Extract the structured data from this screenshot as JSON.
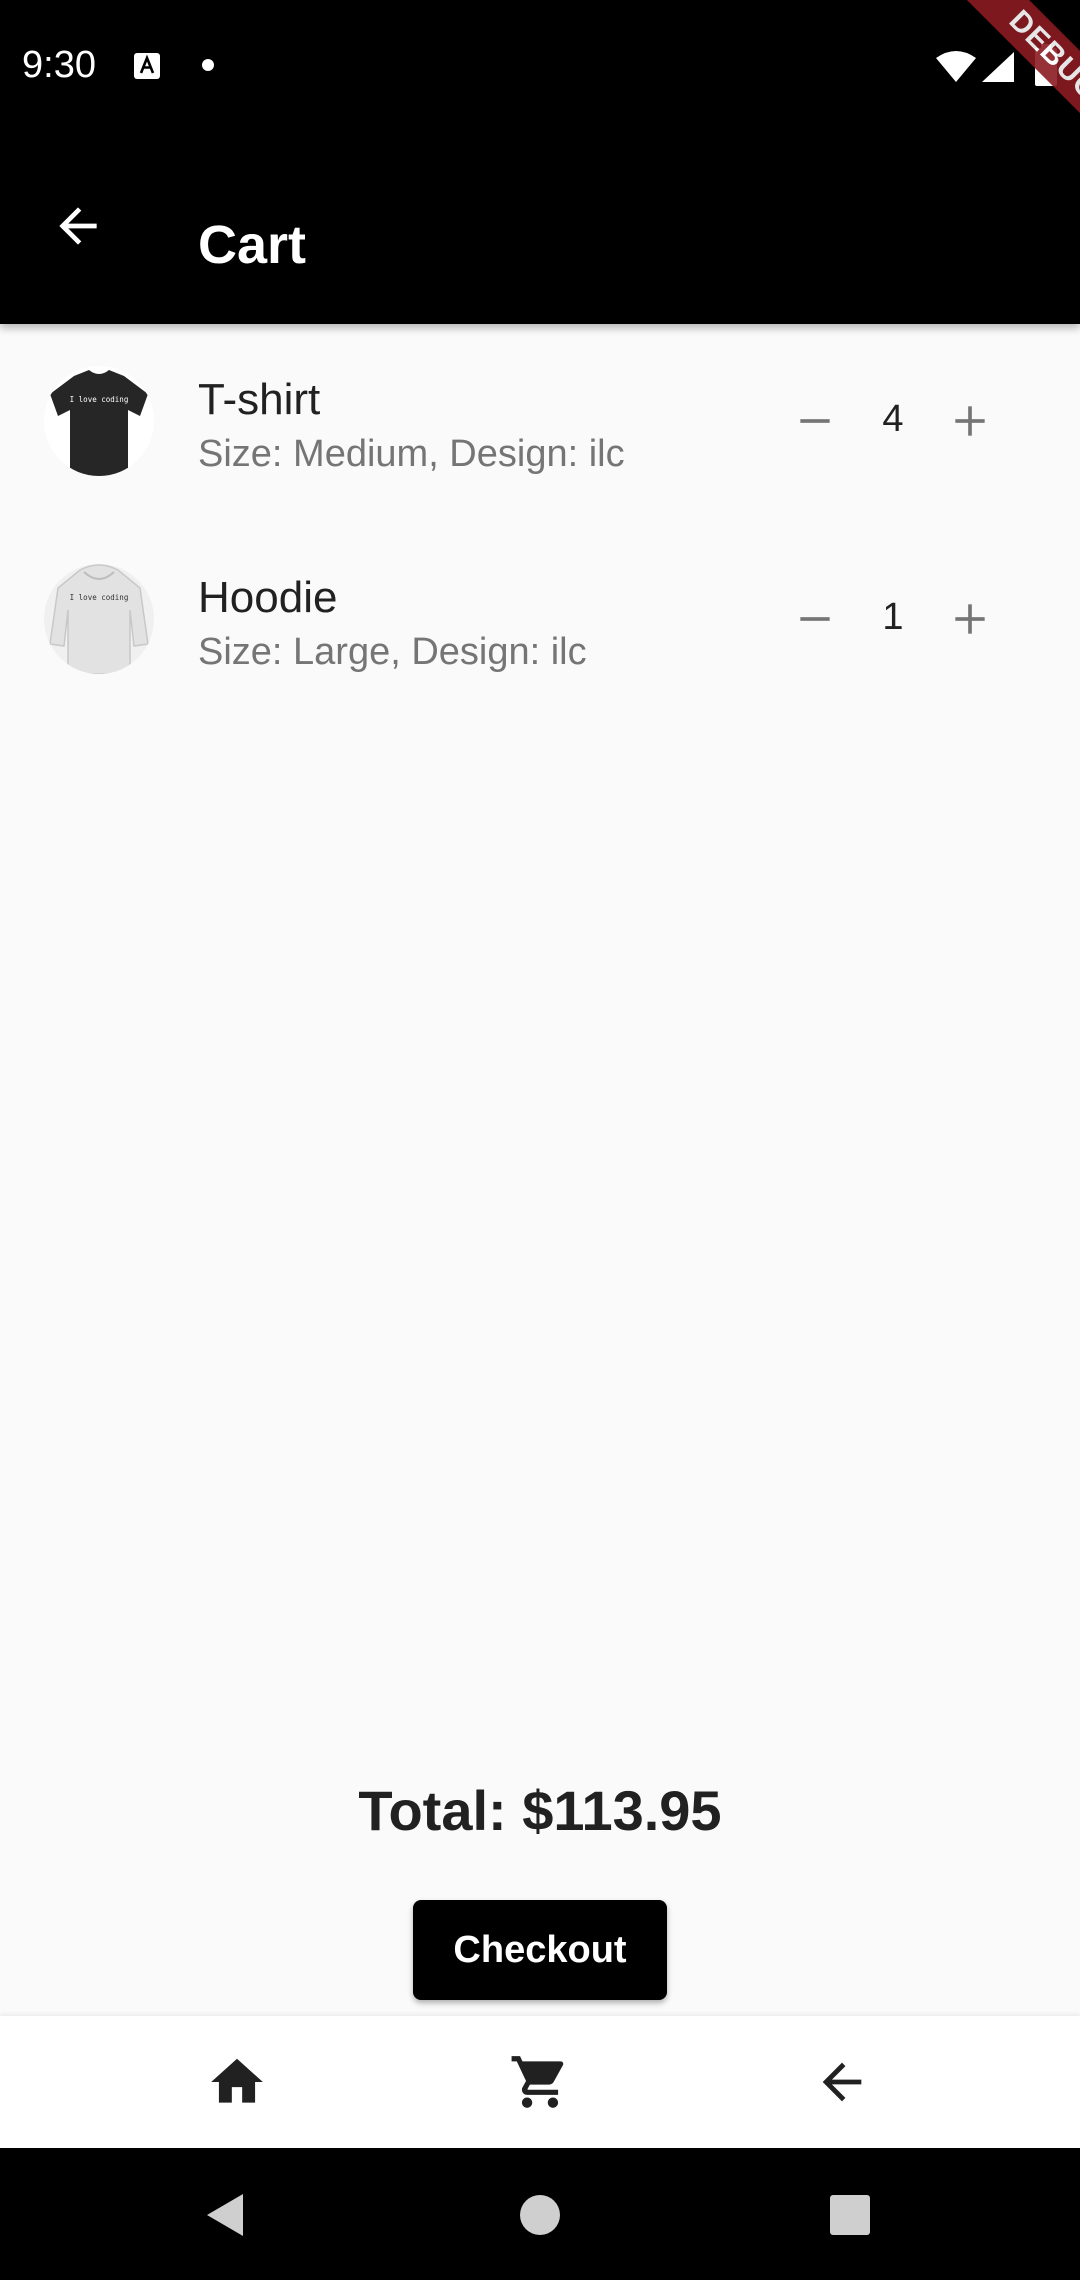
{
  "status_bar": {
    "time": "9:30",
    "icons": [
      "accessibility-a-icon",
      "notification-dot-icon",
      "wifi-icon",
      "signal-icon",
      "battery-icon"
    ]
  },
  "debug_banner": "DEBUG",
  "app_bar": {
    "title": "Cart",
    "back_icon": "arrow-back-icon"
  },
  "cart": {
    "items": [
      {
        "name": "T-shirt",
        "details": "Size: Medium, Design: ilc",
        "quantity": "4",
        "image": "black-tshirt-thumbnail",
        "image_text": "I love coding"
      },
      {
        "name": "Hoodie",
        "details": "Size: Large, Design: ilc",
        "quantity": "1",
        "image": "white-hoodie-thumbnail",
        "image_text": "I love coding"
      }
    ]
  },
  "total_label": "Total: $113.95",
  "checkout_label": "Checkout",
  "bottom_nav": [
    "home-icon",
    "cart-icon",
    "arrow-back-icon"
  ],
  "system_nav": [
    "back-triangle-icon",
    "home-circle-icon",
    "recents-square-icon"
  ],
  "colors": {
    "app_bar": "#000000",
    "background": "#fafafa",
    "button": "#000000",
    "text_primary": "#212121",
    "text_secondary": "#757575",
    "debug_ribbon": "#8b1b22"
  }
}
